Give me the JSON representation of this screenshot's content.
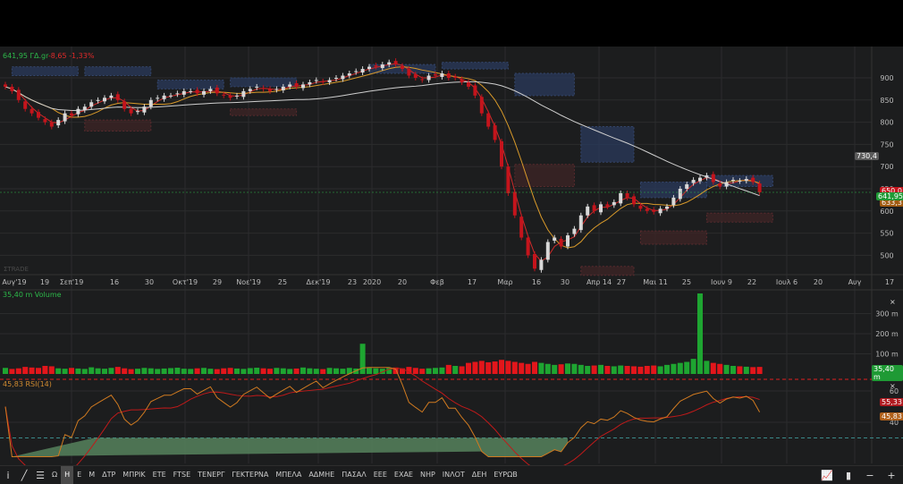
{
  "header": {
    "price": "641,95",
    "symbol": "ΓΔ.gr",
    "change": "-8,65",
    "change_pct": "-1,33%"
  },
  "watermark": "ΣTRADE",
  "price_axis": [
    "900",
    "850",
    "800",
    "750",
    "700",
    "650",
    "600",
    "550",
    "500"
  ],
  "price_tags": {
    "ma_long": "730,4",
    "ma_mid": "650,0",
    "last": "641,95",
    "ma_short": "633,3"
  },
  "time_axis": [
    "Αυγ'19",
    "19",
    "Σεπ'19",
    "16",
    "30",
    "Οκτ'19",
    "29",
    "Νοε'19",
    "25",
    "Δεκ'19",
    "23",
    "2020",
    "20",
    "Φεβ",
    "17",
    "Μαρ",
    "16",
    "30",
    "Απρ 14",
    "27",
    "Μαι 11",
    "25",
    "Ιουν 9",
    "22",
    "Ιουλ 6",
    "20",
    "Αυγ",
    "17"
  ],
  "volume_pane": {
    "title": "35,40 m Volume",
    "axis": [
      "300 m",
      "200 m",
      "100 m"
    ],
    "last_tag": "35,40 m"
  },
  "rsi_pane": {
    "title": "45,83 RSI(14)",
    "axis": [
      "60",
      "40"
    ],
    "tag_signal": "55,33",
    "tag_rsi": "45,83"
  },
  "toolbar": {
    "items": [
      "Ω",
      "Η",
      "Ε",
      "Μ",
      "ΔΤΡ",
      "ΜΠΡΙΚ",
      "ΕΤΕ",
      "FTSE",
      "ΤΕΝΕΡΓ",
      "ΓΕΚΤΕΡΝΑ",
      "ΜΠΕΛΑ",
      "ΑΔΜΗΕ",
      "ΠΑΣΑΛ",
      "ΕΕΕ",
      "ΕΧΑΕ",
      "ΝΗΡ",
      "ΙΝΛΟΤ",
      "ΔΕΗ",
      "ΕΥΡΩΒ"
    ],
    "active": "Η"
  },
  "colors": {
    "up": "#d8d8d8",
    "down": "#c4141c",
    "vol_up": "#1ea531",
    "vol_down": "#e3161b",
    "ma1": "#d12a2a",
    "ma2": "#d99a2a",
    "ma3": "#cfcfcf",
    "rsi": "#d07a20"
  },
  "chart_data": {
    "type": "candlestick",
    "closes": [
      880,
      870,
      850,
      830,
      820,
      810,
      800,
      790,
      805,
      820,
      815,
      830,
      835,
      845,
      850,
      855,
      860,
      850,
      830,
      820,
      825,
      835,
      850,
      855,
      860,
      860,
      865,
      870,
      870,
      865,
      870,
      875,
      865,
      860,
      855,
      860,
      870,
      875,
      880,
      875,
      870,
      875,
      880,
      885,
      880,
      885,
      890,
      895,
      890,
      895,
      900,
      905,
      910,
      915,
      920,
      925,
      925,
      930,
      935,
      930,
      920,
      905,
      900,
      895,
      905,
      905,
      910,
      900,
      900,
      890,
      880,
      860,
      820,
      790,
      760,
      700,
      640,
      590,
      540,
      500,
      470,
      490,
      530,
      540,
      520,
      545,
      560,
      590,
      610,
      600,
      615,
      610,
      620,
      640,
      630,
      615,
      605,
      600,
      598,
      605,
      610,
      630,
      650,
      660,
      670,
      675,
      680,
      665,
      655,
      665,
      670,
      668,
      672,
      665,
      642
    ],
    "volumes_m": [
      30,
      25,
      28,
      35,
      32,
      30,
      40,
      38,
      28,
      26,
      30,
      27,
      25,
      33,
      28,
      26,
      30,
      35,
      28,
      24,
      26,
      30,
      28,
      25,
      27,
      29,
      31,
      26,
      25,
      28,
      30,
      26,
      24,
      28,
      30,
      27,
      25,
      29,
      31,
      28,
      26,
      30,
      28,
      25,
      27,
      32,
      28,
      26,
      24,
      30,
      28,
      26,
      30,
      27,
      150,
      30,
      28,
      26,
      30,
      32,
      28,
      35,
      30,
      26,
      28,
      30,
      32,
      45,
      40,
      38,
      55,
      60,
      65,
      58,
      62,
      70,
      65,
      60,
      55,
      50,
      60,
      55,
      50,
      45,
      48,
      52,
      50,
      45,
      40,
      42,
      45,
      40,
      38,
      42,
      40,
      38,
      36,
      40,
      42,
      38,
      45,
      50,
      55,
      60,
      75,
      400,
      65,
      55,
      50,
      45,
      40,
      38,
      36,
      34,
      35
    ],
    "zones": [
      {
        "type": "supply",
        "from": 1,
        "to": 11,
        "low": 905,
        "high": 925
      },
      {
        "type": "supply",
        "from": 12,
        "to": 22,
        "low": 905,
        "high": 925
      },
      {
        "type": "supply",
        "from": 23,
        "to": 33,
        "low": 875,
        "high": 895
      },
      {
        "type": "supply",
        "from": 34,
        "to": 44,
        "low": 880,
        "high": 900
      },
      {
        "type": "supply",
        "from": 55,
        "to": 65,
        "low": 910,
        "high": 930
      },
      {
        "type": "supply",
        "from": 66,
        "to": 76,
        "low": 920,
        "high": 935
      },
      {
        "type": "supply",
        "from": 77,
        "to": 86,
        "low": 860,
        "high": 910
      },
      {
        "type": "supply",
        "from": 87,
        "to": 95,
        "low": 710,
        "high": 790
      },
      {
        "type": "supply",
        "from": 96,
        "to": 106,
        "low": 630,
        "high": 665
      },
      {
        "type": "supply",
        "from": 106,
        "to": 116,
        "low": 655,
        "high": 680
      },
      {
        "type": "demand",
        "from": 12,
        "to": 22,
        "low": 780,
        "high": 805
      },
      {
        "type": "demand",
        "from": 34,
        "to": 44,
        "low": 815,
        "high": 830
      },
      {
        "type": "demand",
        "from": 77,
        "to": 86,
        "low": 655,
        "high": 705
      },
      {
        "type": "demand",
        "from": 87,
        "to": 95,
        "low": 455,
        "high": 475
      },
      {
        "type": "demand",
        "from": 96,
        "to": 106,
        "low": 525,
        "high": 555
      },
      {
        "type": "demand",
        "from": 106,
        "to": 116,
        "low": 575,
        "high": 595
      }
    ],
    "ylim": [
      450,
      960
    ],
    "rsi_period": 14
  }
}
